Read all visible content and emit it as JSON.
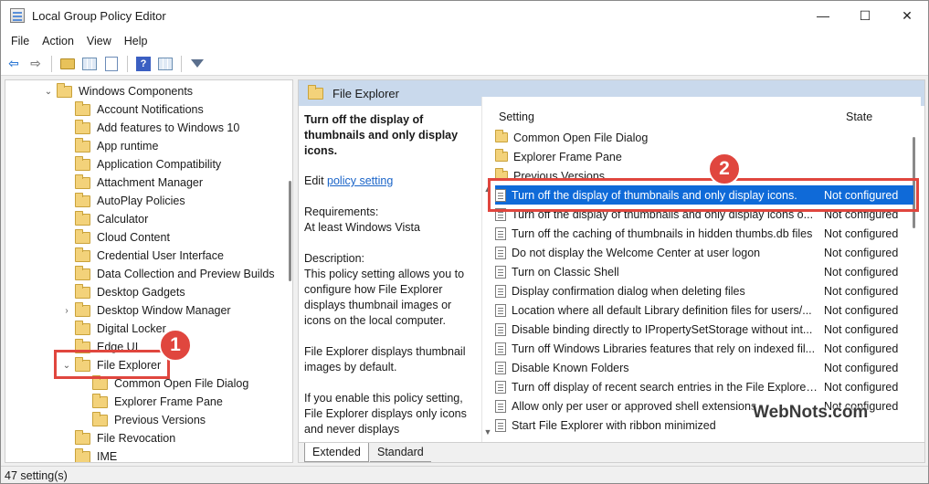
{
  "window": {
    "title": "Local Group Policy Editor",
    "controls": [
      "—",
      "☐",
      "✕"
    ]
  },
  "menu": [
    "File",
    "Action",
    "View",
    "Help"
  ],
  "tree": {
    "items": [
      {
        "label": "Windows Components",
        "chevron": "v",
        "expanded": true
      },
      {
        "label": "Account Notifications"
      },
      {
        "label": "Add features to Windows 10"
      },
      {
        "label": "App runtime"
      },
      {
        "label": "Application Compatibility"
      },
      {
        "label": "Attachment Manager"
      },
      {
        "label": "AutoPlay Policies"
      },
      {
        "label": "Calculator"
      },
      {
        "label": "Cloud Content"
      },
      {
        "label": "Credential User Interface"
      },
      {
        "label": "Data Collection and Preview Builds"
      },
      {
        "label": "Desktop Gadgets"
      },
      {
        "label": "Desktop Window Manager",
        "chevron": ">"
      },
      {
        "label": "Digital Locker"
      },
      {
        "label": "Edge UI"
      },
      {
        "label": "File Explorer",
        "chevron": "v",
        "expanded": true
      },
      {
        "label": "Common Open File Dialog"
      },
      {
        "label": "Explorer Frame Pane"
      },
      {
        "label": "Previous Versions"
      },
      {
        "label": "File Revocation"
      },
      {
        "label": "IME"
      }
    ]
  },
  "right": {
    "header": "File Explorer",
    "description": {
      "title": "Turn off the display of thumbnails and only display icons.",
      "edit_prefix": "Edit",
      "edit_link": "policy setting",
      "requirements_label": "Requirements:",
      "requirements_value": "At least Windows Vista",
      "description_label": "Description:",
      "description_text": "This policy setting allows you to configure how File Explorer displays thumbnail images or icons on the local computer.",
      "paragraph2": "File Explorer displays thumbnail images by default.",
      "paragraph3": "If you enable this policy setting, File Explorer displays only icons and never displays"
    },
    "list": {
      "col_setting": "Setting",
      "col_state": "State",
      "rows": [
        {
          "type": "folder",
          "name": "Common Open File Dialog",
          "state": ""
        },
        {
          "type": "folder",
          "name": "Explorer Frame Pane",
          "state": ""
        },
        {
          "type": "folder",
          "name": "Previous Versions",
          "state": ""
        },
        {
          "type": "policy",
          "name": "Turn off the display of thumbnails and only display icons.",
          "state": "Not configured",
          "selected": true
        },
        {
          "type": "policy",
          "name": "Turn off the display of thumbnails and only display icons o...",
          "state": "Not configured"
        },
        {
          "type": "policy",
          "name": "Turn off the caching of thumbnails in hidden thumbs.db files",
          "state": "Not configured"
        },
        {
          "type": "policy",
          "name": "Do not display the Welcome Center at user logon",
          "state": "Not configured"
        },
        {
          "type": "policy",
          "name": "Turn on Classic Shell",
          "state": "Not configured"
        },
        {
          "type": "policy",
          "name": "Display confirmation dialog when deleting files",
          "state": "Not configured"
        },
        {
          "type": "policy",
          "name": "Location where all default Library definition files for users/...",
          "state": "Not configured"
        },
        {
          "type": "policy",
          "name": "Disable binding directly to IPropertySetStorage without int...",
          "state": "Not configured"
        },
        {
          "type": "policy",
          "name": "Turn off Windows Libraries features that rely on indexed fil...",
          "state": "Not configured"
        },
        {
          "type": "policy",
          "name": "Disable Known Folders",
          "state": "Not configured"
        },
        {
          "type": "policy",
          "name": "Turn off display of recent search entries in the File Explorer...",
          "state": "Not configured"
        },
        {
          "type": "policy",
          "name": "Allow only per user or approved shell extensions",
          "state": "Not configured"
        },
        {
          "type": "policy",
          "name": "Start File Explorer with ribbon minimized",
          "state": ""
        }
      ]
    },
    "tabs": [
      "Extended",
      "Standard"
    ]
  },
  "status": "47 setting(s)",
  "annotations": {
    "badge1": "1",
    "badge2": "2",
    "watermark": "WebNots.com"
  },
  "colors": {
    "selection": "#0f6ad8",
    "annotation_red": "#e0463e",
    "header_blue": "#c9d9ec",
    "folder_yellow": "#f3d27a"
  }
}
